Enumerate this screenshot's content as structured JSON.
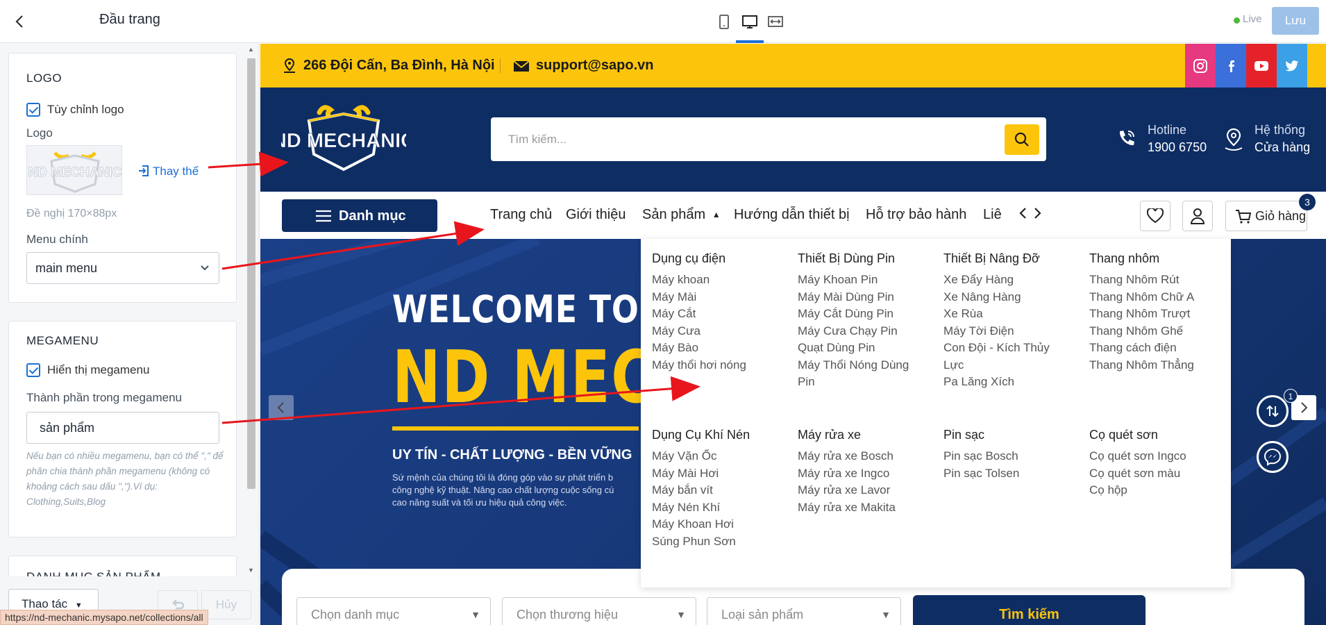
{
  "editor": {
    "title": "Đầu trang",
    "logo_section": {
      "title": "LOGO",
      "custom_logo_label": "Tùy chỉnh logo",
      "logo_label": "Logo",
      "replace_label": "Thay thế",
      "size_hint": "Đề nghị 170×88px",
      "main_menu_label": "Menu chính",
      "main_menu_value": "main menu"
    },
    "megamenu_section": {
      "title": "MEGAMENU",
      "show_label": "Hiển thị megamenu",
      "component_label": "Thành phần trong megamenu",
      "component_value": "sản phẩm",
      "note": "Nếu bạn có nhiều megamenu, bạn có thể \",\" để phân chia thành phần megamenu (không có khoảng cách sau dấu \",\").Ví dụ: Clothing,Suits,Blog"
    },
    "next_section_title": "DANH MỤC SẢN PHẨM",
    "actions_label": "Thao tác",
    "cancel_label": "Hủy",
    "status_url": "https://nd-mechanic.mysapo.net/collections/all"
  },
  "toolbar": {
    "live_label": "Live",
    "save_label": "Lưu"
  },
  "site": {
    "address": "266 Đội Cấn, Ba Đình, Hà Nội",
    "email": "support@sapo.vn",
    "logo_text": "ND MECHANIC",
    "search_placeholder": "Tìm kiếm...",
    "hotline_label": "Hotline",
    "hotline_number": "1900 6750",
    "stores_label": "Hệ thống",
    "stores_sub": "Cửa hàng",
    "category_button": "Danh mục",
    "nav": [
      "Trang chủ",
      "Giới thiệu",
      "Sản phẩm",
      "Hướng dẫn thiết bị",
      "Hỗ trợ bảo hành",
      "Liê"
    ],
    "cart_label": "Giỏ hàng",
    "cart_count": "3",
    "float_badge": "1",
    "hero": {
      "welcome": "WELCOME TO",
      "brand": "ND MECH",
      "slogan": "UY TÍN - CHẤT LƯỢNG - BỀN VỮNG",
      "desc_line1": "Sứ mệnh của chúng tôi là đóng góp vào sự phát triển b",
      "desc_line2": "công nghệ kỹ thuật. Nâng cao chất lượng cuộc sống cú",
      "desc_line3": "cao năng suất và tối ưu hiệu quả công việc."
    },
    "filters": {
      "category": "Chọn danh mục",
      "brand": "Chọn thương hiệu",
      "type": "Loại sản phẩm",
      "search": "Tìm kiếm"
    }
  },
  "megamenu": {
    "row1": [
      {
        "title": "Dụng cụ điện",
        "items": [
          "Máy khoan",
          "Máy Mài",
          "Máy Cắt",
          "Máy Cưa",
          "Máy Bào",
          "Máy thổi hơi nóng"
        ]
      },
      {
        "title": "Thiết Bị Dùng Pin",
        "items": [
          "Máy Khoan Pin",
          "Máy Mài Dùng Pin",
          "Máy Cắt Dùng Pin",
          "Máy Cưa Chạy Pin",
          "Quạt Dùng Pin",
          "Máy Thổi Nóng Dùng",
          "Pin"
        ]
      },
      {
        "title": "Thiết Bị Nâng Đỡ",
        "items": [
          "Xe Đẩy Hàng",
          "Xe Nâng Hàng",
          "Xe Rùa",
          "Máy Tời Điện",
          "Con Đội - Kích Thủy",
          "Lực",
          "Pa Lăng Xích"
        ]
      },
      {
        "title": "Thang nhôm",
        "items": [
          "Thang Nhôm Rút",
          "Thang Nhôm Chữ A",
          "Thang Nhôm Trượt",
          "Thang Nhôm Ghế",
          "Thang cách điện",
          "Thang Nhôm Thẳng"
        ]
      }
    ],
    "row2": [
      {
        "title": "Dụng Cụ Khí Nén",
        "items": [
          "Máy Vặn Ốc",
          "Máy Mài Hơi",
          "Máy bắn vít",
          "Máy Nén Khí",
          "Máy Khoan Hơi",
          "Súng Phun Sơn"
        ]
      },
      {
        "title": "Máy rửa xe",
        "items": [
          "Máy rửa xe Bosch",
          "Máy rửa xe Ingco",
          "Máy rửa xe Lavor",
          "Máy rửa xe Makita"
        ]
      },
      {
        "title": "Pin sạc",
        "items": [
          "Pin sạc Bosch",
          "Pin sạc Tolsen"
        ]
      },
      {
        "title": "Cọ quét sơn",
        "items": [
          "Cọ quét sơn Ingco",
          "Cọ quét sơn màu",
          "Cọ hộp"
        ]
      }
    ]
  },
  "colors": {
    "navy": "#0e2d63",
    "yellow": "#fcc50c",
    "accent_blue": "#1b6fd6",
    "arrow_red": "#e8161c"
  }
}
